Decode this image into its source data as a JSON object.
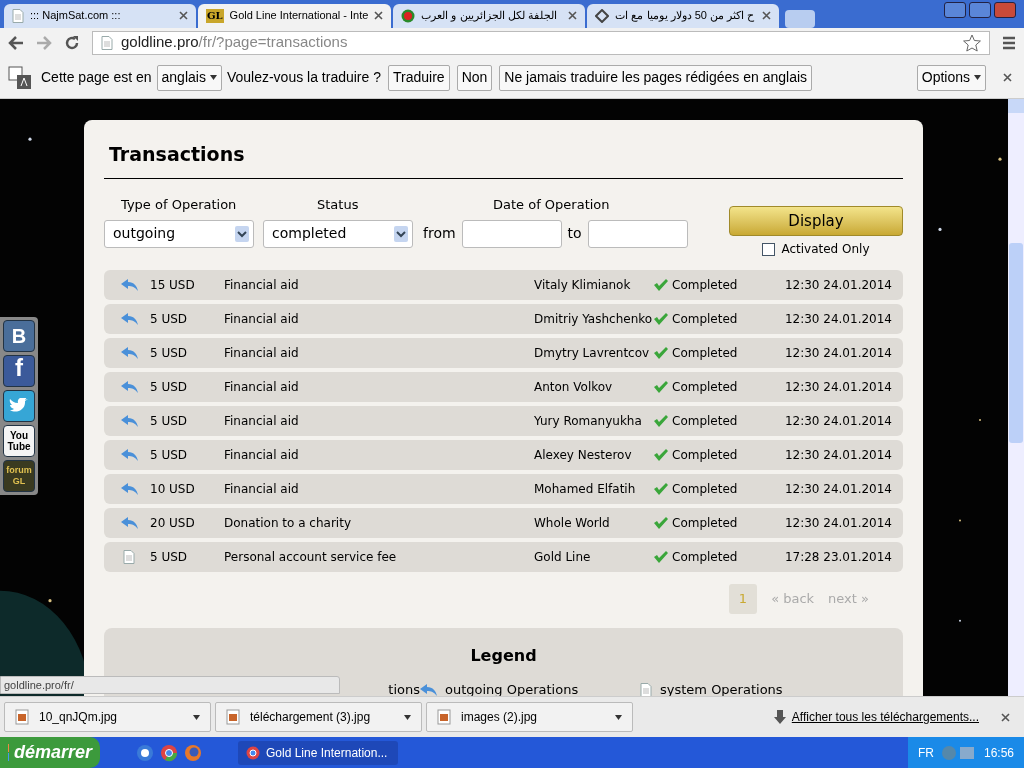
{
  "tabs": [
    {
      "title": "::: NajmSat.com :::",
      "selected": false
    },
    {
      "title": "Gold Line International - Inte",
      "selected": true
    },
    {
      "title": "الجلفة لكل الجزائريين و العرب",
      "selected": false
    },
    {
      "title": "ح اكثر من 50 دولار يوميا مع ات",
      "selected": false
    }
  ],
  "gl_favicon_text": "GL",
  "address": {
    "host": "goldline.pro",
    "path": "/fr/?page=transactions"
  },
  "translate_bar": {
    "text_before": "Cette page est en",
    "language": "anglais",
    "text_after": "Voulez-vous la traduire ?",
    "buttons": [
      "Traduire",
      "Non",
      "Ne jamais traduire les pages rédigées en anglais"
    ],
    "options": "Options"
  },
  "social": [
    {
      "kind": "vk",
      "label": "B"
    },
    {
      "kind": "facebook",
      "label": "f"
    },
    {
      "kind": "twitter"
    },
    {
      "kind": "youtube",
      "label": "You Tube"
    },
    {
      "kind": "forum",
      "label": "forum GL"
    }
  ],
  "page": {
    "title": "Transactions",
    "filters": {
      "type_label": "Type of Operation",
      "type_value": "outgoing",
      "status_label": "Status",
      "status_value": "completed",
      "date_label": "Date of Operation",
      "from_label": "from",
      "to_label": "to",
      "display_button": "Display",
      "activated_only": {
        "label": "Activated Only",
        "checked": false
      }
    },
    "rows": [
      {
        "kind": "outgoing",
        "amount": "15 USD",
        "description": "Financial aid",
        "name": "Vitaly Klimianok",
        "status": "Completed",
        "date": "12:30 24.01.2014"
      },
      {
        "kind": "outgoing",
        "amount": "5 USD",
        "description": "Financial aid",
        "name": "Dmitriy Yashchenko",
        "status": "Completed",
        "date": "12:30 24.01.2014"
      },
      {
        "kind": "outgoing",
        "amount": "5 USD",
        "description": "Financial aid",
        "name": "Dmytry Lavrentcov",
        "status": "Completed",
        "date": "12:30 24.01.2014"
      },
      {
        "kind": "outgoing",
        "amount": "5 USD",
        "description": "Financial aid",
        "name": "Anton Volkov",
        "status": "Completed",
        "date": "12:30 24.01.2014"
      },
      {
        "kind": "outgoing",
        "amount": "5 USD",
        "description": "Financial aid",
        "name": "Yury Romanyukha",
        "status": "Completed",
        "date": "12:30 24.01.2014"
      },
      {
        "kind": "outgoing",
        "amount": "5 USD",
        "description": "Financial aid",
        "name": "Alexey Nesterov",
        "status": "Completed",
        "date": "12:30 24.01.2014"
      },
      {
        "kind": "outgoing",
        "amount": "10 USD",
        "description": "Financial aid",
        "name": "Mohamed Elfatih",
        "status": "Completed",
        "date": "12:30 24.01.2014"
      },
      {
        "kind": "outgoing",
        "amount": "20 USD",
        "description": "Donation to a charity",
        "name": "Whole World",
        "status": "Completed",
        "date": "12:30 24.01.2014"
      },
      {
        "kind": "system",
        "amount": "5 USD",
        "description": "Personal account service fee",
        "name": "Gold Line",
        "status": "Completed",
        "date": "17:28 23.01.2014"
      }
    ],
    "pagination": [
      {
        "label": "1",
        "selected": true
      },
      {
        "label": "« back",
        "selected": false
      },
      {
        "label": "next »",
        "selected": false
      }
    ],
    "legend": {
      "title": "Legend",
      "items": [
        {
          "label": "tions"
        },
        {
          "kind": "outgoing",
          "label": "outgoing Operations"
        },
        {
          "kind": "system",
          "label": "system Operations"
        }
      ]
    }
  },
  "status_url": "goldline.pro/fr/",
  "downloads": {
    "files": [
      "10_qnJQm.jpg",
      "téléchargement (3).jpg",
      "images (2).jpg"
    ],
    "show_all": "Afficher tous les téléchargements..."
  },
  "taskbar": {
    "start": "démarrer",
    "window": "Gold Line Internation...",
    "language": "FR",
    "clock": "16:56"
  }
}
